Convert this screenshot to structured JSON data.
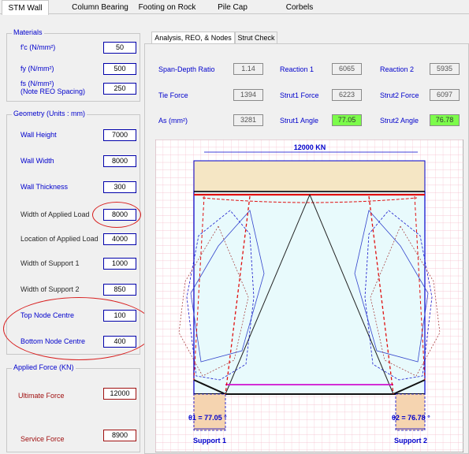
{
  "tabs": [
    "STM Wall",
    "Column Bearing",
    "Footing on Rock",
    "Pile Cap",
    "Corbels"
  ],
  "materials": {
    "title": "Materials",
    "fc": {
      "label": "f'c (N/mm²)",
      "value": "50"
    },
    "fy": {
      "label": "fy  (N/mm²)",
      "value": "500"
    },
    "fs": {
      "label": "fs  (N/mm²)",
      "label2": "(Note REO Spacing)",
      "value": "250"
    }
  },
  "geometry": {
    "title": "Geometry (Units : mm)",
    "fields": [
      {
        "label": "Wall Height",
        "value": "7000"
      },
      {
        "label": "Wall Width",
        "value": "8000"
      },
      {
        "label": "Wall Thickness",
        "value": "300"
      },
      {
        "label": "Width of Applied Load",
        "value": "8000"
      },
      {
        "label": "Location of Applied Load",
        "value": "4000"
      },
      {
        "label": "Width of Support 1",
        "value": "1000"
      },
      {
        "label": "Width of Support 2",
        "value": "850"
      },
      {
        "label": "Top Node Centre",
        "value": "100"
      },
      {
        "label": "Bottom Node Centre",
        "value": "400"
      }
    ]
  },
  "applied_force": {
    "title": "Applied Force (KN)",
    "ultimate": {
      "label": "Ultimate Force",
      "value": "12000"
    },
    "service": {
      "label": "Service Force",
      "value": "8900"
    }
  },
  "right_tabs": [
    "Analysis, REO, & Nodes",
    "Strut Check"
  ],
  "results": {
    "span_depth": {
      "label": "Span-Depth Ratio",
      "value": "1.14"
    },
    "reaction1": {
      "label": "Reaction 1",
      "value": "6065"
    },
    "reaction2": {
      "label": "Reaction 2",
      "value": "5935"
    },
    "tie_force": {
      "label": "Tie Force",
      "value": "1394"
    },
    "strut1_force": {
      "label": "Strut1 Force",
      "value": "6223"
    },
    "strut2_force": {
      "label": "Strut2 Force",
      "value": "6097"
    },
    "as": {
      "label": "As (mm²)",
      "value": "3281"
    },
    "strut1_angle": {
      "label": "Strut1 Angle",
      "value": "77.05"
    },
    "strut2_angle": {
      "label": "Strut2 Angle",
      "value": "76.78"
    }
  },
  "drawing": {
    "load_label": "12000 KN",
    "theta1": "θ1 = 77.05 °",
    "theta2": "θ2 = 76.78 °",
    "support1": "Support 1",
    "support2": "Support 2"
  },
  "colors": {
    "tab_blue": "#0000cc",
    "dark_red": "#a01010",
    "highlight_green": "#7cfc4a",
    "grid_pink": "#f4b8c8"
  }
}
